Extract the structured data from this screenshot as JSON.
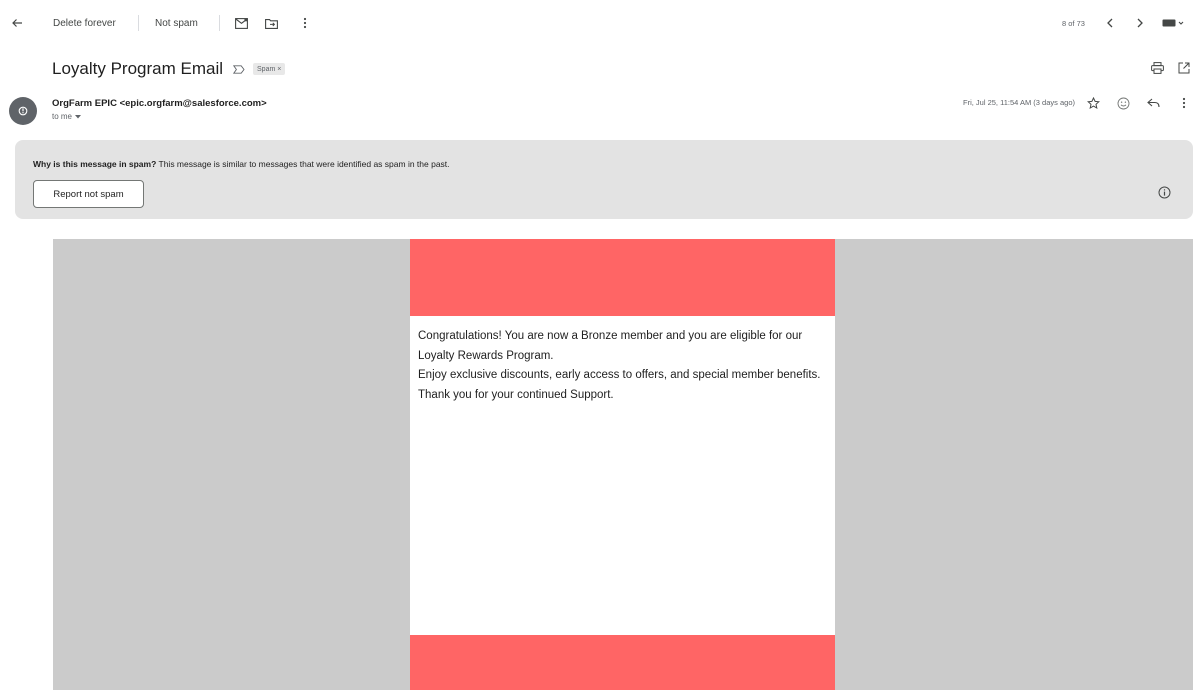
{
  "toolbar": {
    "back_icon": "arrow-left-icon",
    "delete_forever_label": "Delete forever",
    "not_spam_label": "Not spam",
    "mark_unread_icon": "envelope-icon",
    "move_to_icon": "folder-move-icon",
    "more_icon": "more-vert-icon",
    "pagination": "8 of 73",
    "prev_icon": "chevron-left-icon",
    "next_icon": "chevron-right-icon",
    "input_tools_icon": "keyboard-icon"
  },
  "message": {
    "subject": "Loyalty Program Email",
    "important_icon": "label-important-icon",
    "label_chip": "Spam ×",
    "print_icon": "print-icon",
    "open_new_window_icon": "open-in-new-icon",
    "sender": "OrgFarm EPIC <epic.orgfarm@salesforce.com>",
    "to": "to me",
    "date": "Fri, Jul 25, 11:54 AM (3 days ago)",
    "star_icon": "star-icon",
    "emoji_icon": "emoji-icon",
    "reply_icon": "reply-icon",
    "more_icon": "more-vert-icon"
  },
  "spam_banner": {
    "title": "Why is this message in spam?",
    "text": " This message is similar to messages that were identified as spam in the past.",
    "button_label": "Report not spam",
    "info_icon": "info-icon"
  },
  "email_body": {
    "line1": "Congratulations! You are now a Bronze member and you are eligible for our Loyalty Rewards Program.",
    "line2": "Enjoy exclusive discounts, early access to offers, and special member benefits.",
    "line3": "Thank you for your continued Support."
  },
  "colors": {
    "banner_red": "#ff6565",
    "email_background": "#cbcbcb",
    "spam_banner_bg": "#e3e3e3"
  }
}
